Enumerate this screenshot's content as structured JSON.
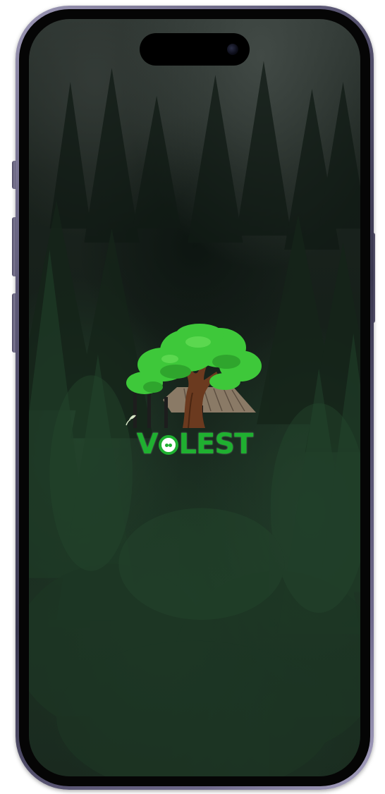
{
  "app": {
    "brand_prefix": "V",
    "brand_suffix": "LEST",
    "brand_full": "VOLEST"
  },
  "colors": {
    "brand_green": "#1fb030",
    "leaf_green": "#3ec83a",
    "trunk_brown": "#6b3a1f",
    "background_forest": "#1a2a1f"
  },
  "icons": {
    "logo": "tree-with-cabin-logo",
    "camera": "camera-lens-icon"
  }
}
